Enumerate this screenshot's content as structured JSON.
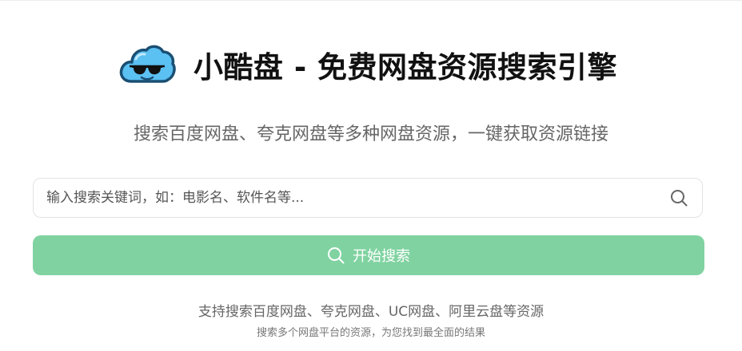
{
  "header": {
    "logo_icon": "cool-cloud-sunglasses-icon",
    "title": "小酷盘 - 免费网盘资源搜索引擎"
  },
  "subtitle": "搜索百度网盘、夸克网盘等多种网盘资源，一键获取资源链接",
  "search": {
    "placeholder": "输入搜索关键词，如：电影名、软件名等...",
    "value": "",
    "icon": "search-icon"
  },
  "search_button": {
    "label": "开始搜索",
    "icon": "search-icon",
    "color": "#80d3a1"
  },
  "footer": {
    "line1": "支持搜索百度网盘、夸克网盘、UC网盘、阿里云盘等资源",
    "line2": "搜索多个网盘平台的资源，为您找到最全面的结果"
  },
  "colors": {
    "logo_cloud": "#5bc0f2",
    "logo_outline": "#1a4f73",
    "title": "#111111",
    "muted_text": "#666666"
  }
}
